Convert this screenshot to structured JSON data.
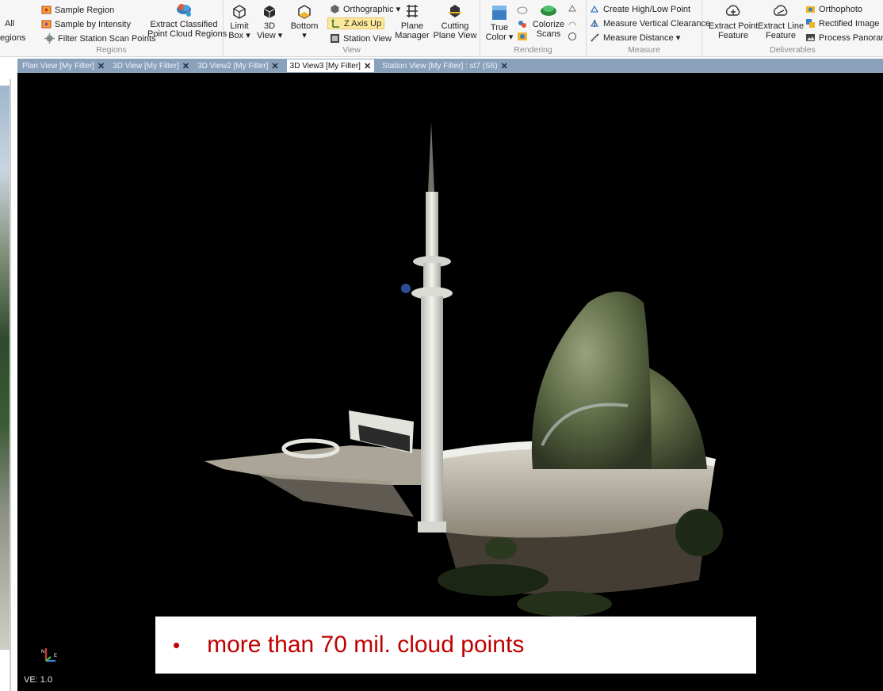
{
  "ribbon": {
    "regions": {
      "group_label": "Regions",
      "left_cut_1": "All",
      "left_cut_2": "egions",
      "sample_region": "Sample Region",
      "sample_by_intensity": "Sample by Intensity",
      "filter_station_scan_points": "Filter Station Scan Points",
      "extract_classified_line1": "Extract Classified",
      "extract_classified_line2": "Point Cloud Regions"
    },
    "view": {
      "group_label": "View",
      "limit_box_line1": "Limit",
      "limit_box_line2": "Box ▾",
      "view3d_line1": "3D",
      "view3d_line2": "View ▾",
      "bottom_line1": "Bottom",
      "bottom_line2": "▾",
      "orthographic": "Orthographic ▾",
      "z_axis_up": "Z Axis Up",
      "station_view": "Station View",
      "plane_manager_line1": "Plane",
      "plane_manager_line2": "Manager",
      "cutting_plane_line1": "Cutting",
      "cutting_plane_line2": "Plane View"
    },
    "rendering": {
      "group_label": "Rendering",
      "true_color_line1": "True",
      "true_color_line2": "Color ▾",
      "colorize_line1": "Colorize",
      "colorize_line2": "Scans"
    },
    "measure": {
      "group_label": "Measure",
      "create_high_low": "Create High/Low Point",
      "measure_vertical": "Measure Vertical Clearance",
      "measure_distance": "Measure Distance ▾"
    },
    "deliverables": {
      "group_label": "Deliverables",
      "extract_point_line1": "Extract Point",
      "extract_point_line2": "Feature",
      "extract_line_line1": "Extract Line",
      "extract_line_line2": "Feature",
      "orthophoto": "Orthophoto",
      "rectified_image": "Rectified Image",
      "process_panorama": "Process Panoram"
    }
  },
  "tabs": [
    {
      "label": "Plan View [My Filter]"
    },
    {
      "label": "3D View [My Filter]"
    },
    {
      "label": "3D View2 [My Filter]"
    },
    {
      "label": "3D View3 [My Filter]"
    },
    {
      "label": "Station View [My Filter] : st7 (S6)"
    }
  ],
  "viewport": {
    "ve_label": "VE: 1.0",
    "axis_n": "N",
    "axis_e": "E",
    "note_bullet": "•",
    "note_text": "more than 70 mil. cloud points"
  },
  "colors": {
    "tab_strip": "#8aa1bc",
    "highlight": "#fde89a",
    "note_text": "#c00000",
    "viewport_bg": "#000000"
  }
}
